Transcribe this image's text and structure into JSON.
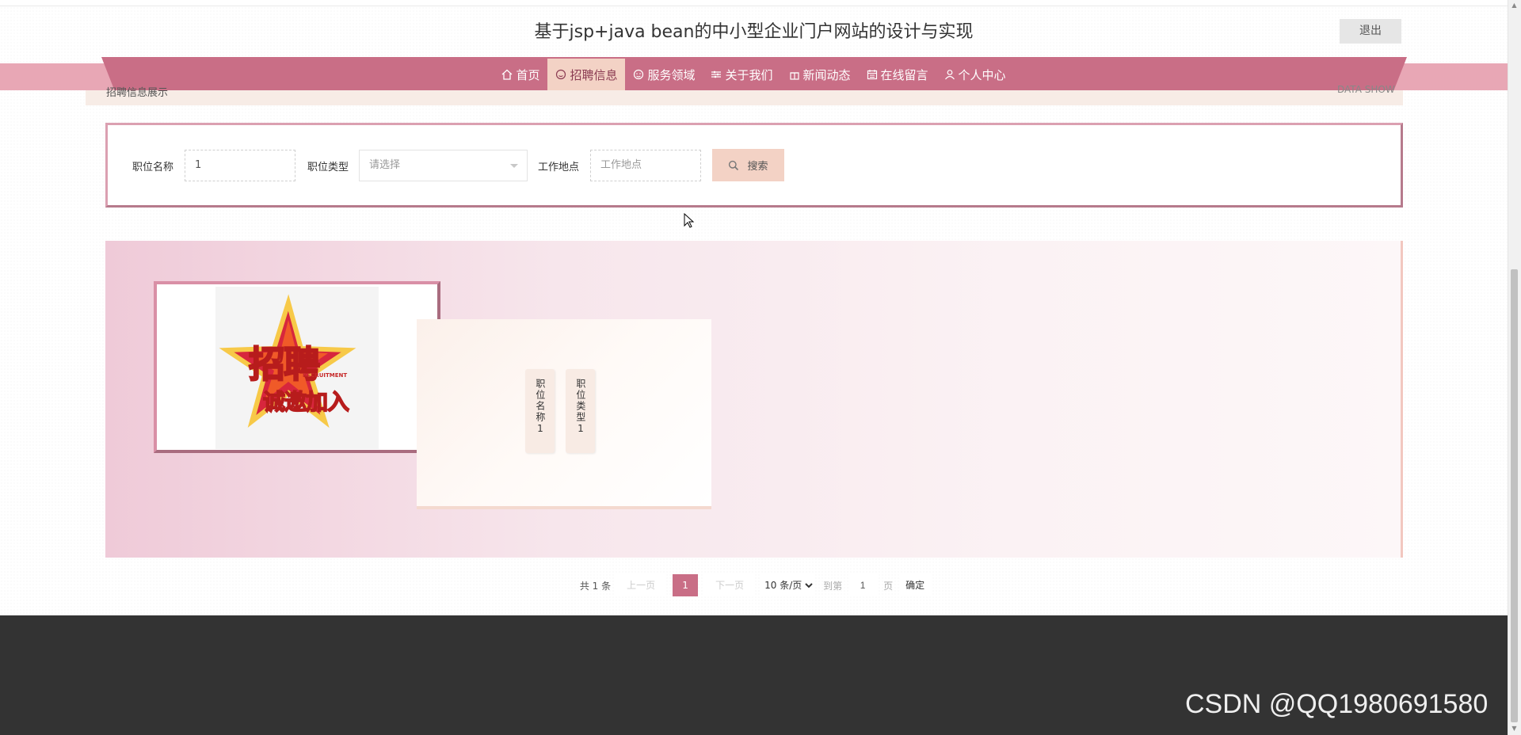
{
  "header": {
    "title": "基于jsp+java bean的中小型企业门户网站的设计与实现",
    "logout": "退出"
  },
  "nav": [
    {
      "label": "首页",
      "icon": "home-icon"
    },
    {
      "label": "招聘信息",
      "icon": "smile-icon",
      "active": true
    },
    {
      "label": "服务领域",
      "icon": "face-icon"
    },
    {
      "label": "关于我们",
      "icon": "sliders-icon"
    },
    {
      "label": "新闻动态",
      "icon": "gift-icon"
    },
    {
      "label": "在线留言",
      "icon": "calendar-icon"
    },
    {
      "label": "个人中心",
      "icon": "user-icon"
    }
  ],
  "section": {
    "title": "招聘信息展示",
    "subtitle": "DATA SHOW"
  },
  "search": {
    "job_name_label": "职位名称",
    "job_name_value": "1",
    "job_type_label": "职位类型",
    "job_type_placeholder": "请选择",
    "location_label": "工作地点",
    "location_placeholder": "工作地点",
    "button": "搜索"
  },
  "listing": {
    "poster_main": "招聘",
    "poster_sub": "诚邀加入",
    "poster_en": "RECRUITMENT",
    "tags": [
      "职位名称1",
      "职位类型1"
    ]
  },
  "pager": {
    "total": "共 1 条",
    "prev": "上一页",
    "current": "1",
    "next": "下一页",
    "page_size": "10 条/页",
    "goto": "到第",
    "goto_value": "1",
    "page_unit": "页",
    "confirm": "确定"
  },
  "watermark": "CSDN @QQ1980691580",
  "colors": {
    "primary": "#c96e86",
    "accent_light": "#f3d2c5",
    "footer": "#333333"
  }
}
